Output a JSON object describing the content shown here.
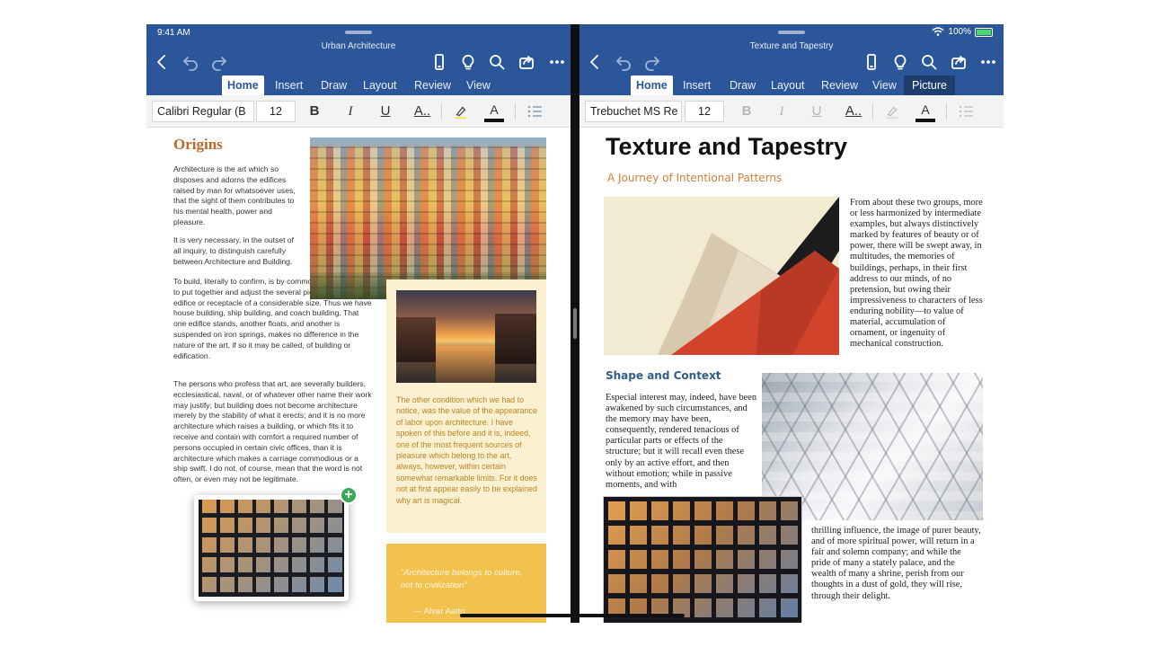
{
  "status": {
    "time": "9:41 AM",
    "battery": "100%"
  },
  "left_doc": {
    "title": "Urban Architecture",
    "tabs": [
      "Home",
      "Insert",
      "Draw",
      "Layout",
      "Review",
      "View"
    ],
    "font": "Calibri Regular (B",
    "size": "12",
    "heading": "Origins",
    "paragraphs": [
      "Architecture is the art which so disposes and adorns the edifices raised by man for whatsoever uses, that the sight of them contributes to his mental health, power and pleasure.",
      "It is very necessary, in the outset of all inquiry, to distinguish carefully between Architecture and Building.",
      "To build, literally to confirm, is by common understanding to put together and adjust the several pieces of any edifice or receptacle of a considerable size. Thus we have house building, ship building, and coach building. That one edifice stands, another floats, and another is suspended on iron springs, makes no difference in the nature of the art, if so it may be called, of building or edification.",
      "The persons who profess that art, are severally builders, ecclesiastical, naval, or of whatever other name their work may justify; but building does not become architecture merely by the stability of what it erects; and it is no more architecture which raises a building, or which fits it to receive and contain with comfort a required number of persons occupied in certain civic offices, than it is architecture which makes a carriage commodious or a ship swift. I do not, of course, mean that the word is not often, or even may not be legitimate."
    ],
    "sidebar_text": "The other condition which we had to notice, was the value of the appearance of labor upon architecture. I have spoken of this before and it is, indeed, one of the most frequent sources of pleasure which belong to the art, always, however, within certain somewhat remarkable limits. For it does not at first appear easily to be explained why art is magical.",
    "quote": "“Architecture belongs to culture, not to civilization”",
    "quote_author": "— Alvar Aalto"
  },
  "right_doc": {
    "title": "Texture and Tapestry",
    "tabs": [
      "Home",
      "Insert",
      "Draw",
      "Layout",
      "Review",
      "View",
      "Picture"
    ],
    "font": "Trebuchet MS Re",
    "size": "12",
    "heading": "Texture and Tapestry",
    "subtitle": "A Journey of Intentional Patterns",
    "para1": "From about these two groups, more or less harmonized by intermediate examples, but always distinctively marked by features of beauty or of power, there will be swept away, in multitudes, the memories of buildings, perhaps, in their first address to our minds, of no pretension, but owing their impressiveness to characters of less enduring nobility—to value of material, accumulation of ornament, or ingenuity of mechanical construction.",
    "section_heading": "Shape and Context",
    "para2": "Especial interest may, indeed, have been awakened by such circumstances, and the memory may have been, consequently, rendered tenacious of particular parts or effects of the structure; but it will recall even these only by an active effort, and then without emotion; while in passive moments, and with",
    "para3": "thrilling influence, the image of purer beauty, and of more spiritual power, will return in a fair and solemn company; and while the pride of many a stately palace, and the wealth of many a shrine, perish from our thoughts in a dust of gold, they will rise, through their delight."
  },
  "colors": {
    "ribbon": "#2b579a",
    "heading_orange": "#b8682a",
    "subtitle_orange": "#d0803a",
    "section_blue": "#2f5d8c",
    "sidebar_bg": "#fbf0cf",
    "quote_bg": "#f2c14e"
  },
  "icons": [
    "back-icon",
    "undo-icon",
    "redo-icon",
    "phone-icon",
    "lightbulb-icon",
    "search-icon",
    "share-icon",
    "more-icon",
    "bold-icon",
    "italic-icon",
    "underline-icon",
    "text-effects-icon",
    "highlighter-icon",
    "font-color-icon",
    "bullets-icon",
    "add-icon",
    "wifi-icon",
    "battery-icon"
  ]
}
